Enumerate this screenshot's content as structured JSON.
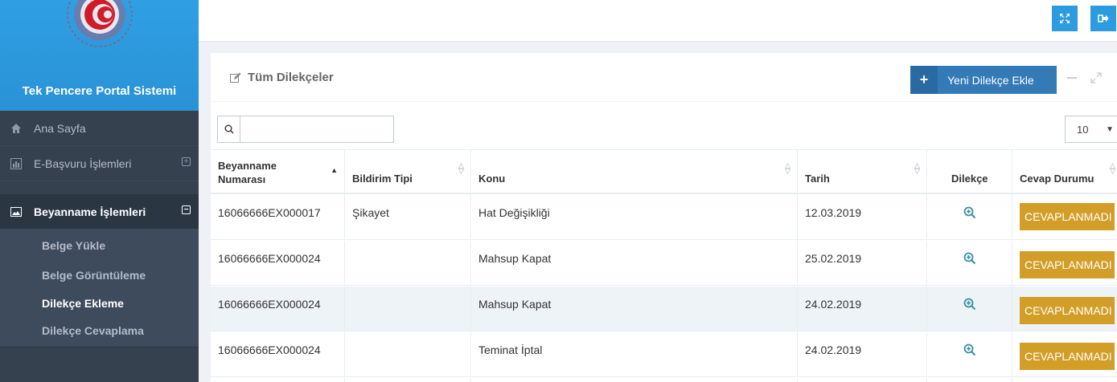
{
  "brand": {
    "title": "Tek Pencere Portal Sistemi"
  },
  "sidebar": {
    "items": [
      {
        "label": "Ana Sayfa",
        "icon": "home-icon"
      },
      {
        "label": "E-Başvuru İşlemleri",
        "icon": "bar-chart-icon",
        "toggle": "⊞"
      },
      {
        "label": "Beyanname İşlemleri",
        "icon": "image-icon",
        "toggle": "⊟"
      }
    ],
    "submenu": [
      {
        "label": "Belge Yükle"
      },
      {
        "label": "Belge Görüntüleme"
      },
      {
        "label": "Dilekçe Ekleme"
      },
      {
        "label": "Dilekçe Cevaplama"
      }
    ]
  },
  "portlet": {
    "title": "Tüm Dilekçeler",
    "add_button": "Yeni Dilekçe Ekle"
  },
  "search": {
    "placeholder": "",
    "value": ""
  },
  "page_size": "10",
  "table": {
    "headers": [
      "Beyanname Numarası",
      "Bildirim Tipi",
      "Konu",
      "Tarih",
      "Dilekçe",
      "Cevap Durumu"
    ],
    "rows": [
      {
        "no": "16066666EX000017",
        "type": "Şikayet",
        "subject": "Hat Değişikliği",
        "date": "12.03.2019",
        "status": "CEVAPLANMADI"
      },
      {
        "no": "16066666EX000024",
        "type": "",
        "subject": "Mahsup Kapat",
        "date": "25.02.2019",
        "status": "CEVAPLANMADI"
      },
      {
        "no": "16066666EX000024",
        "type": "",
        "subject": "Mahsup Kapat",
        "date": "24.02.2019",
        "status": "CEVAPLANMADI"
      },
      {
        "no": "16066666EX000024",
        "type": "",
        "subject": "Teminat İptal",
        "date": "24.02.2019",
        "status": "CEVAPLANMADI"
      }
    ]
  },
  "colors": {
    "brand": "#2c9be0",
    "sidebar": "#364150",
    "primary": "#337ab7",
    "warning": "#d39e27"
  }
}
